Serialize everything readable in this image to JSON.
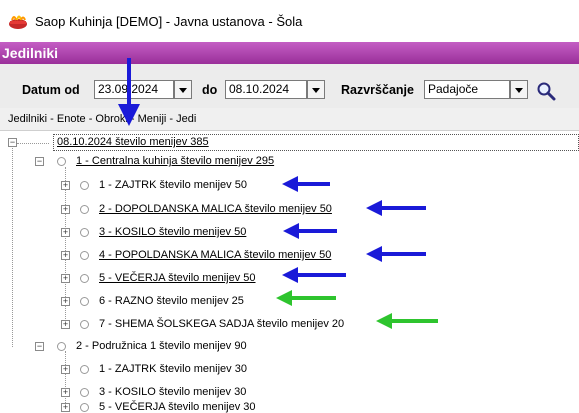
{
  "window": {
    "title": "Saop Kuhinja  [DEMO] - Javna ustanova - Šola"
  },
  "section": {
    "title": "Jedilniki"
  },
  "filters": {
    "date_from_label": "Datum od",
    "date_from_value": "23.09.2024",
    "date_to_label": "do",
    "date_to_value": "08.10.2024",
    "sort_label": "Razvrščanje",
    "sort_value": "Padajoče"
  },
  "breadcrumb": "Jedilniki - Enote - Obroki - Meniji - Jedi",
  "tree": {
    "root": "08.10.2024  število menijev 385",
    "unit1": "1 - Centralna kuhinja   število menijev 295",
    "unit1_items": [
      "1 - ZAJTRK   število menijev 50",
      "2 - DOPOLDANSKA MALICA   število menijev 50",
      "3 - KOSILO   število menijev 50",
      "4 - POPOLDANSKA MALICA   število menijev 50",
      "5 - VEČERJA   število menijev 50",
      "6 - RAZNO   število menijev 25",
      "7 - SHEMA ŠOLSKEGA SADJA   število menijev 20"
    ],
    "unit2": "2 - Podružnica 1   število menijev 90",
    "unit2_items": [
      "1 - ZAJTRK   število menijev 30",
      "3 - KOSILO   število menijev 30",
      "5 - VEČERJA   število menijev 30"
    ]
  },
  "colors": {
    "header": "#a83aa8",
    "arrow_blue": "#1a1ad8",
    "arrow_green": "#2ec42e"
  }
}
